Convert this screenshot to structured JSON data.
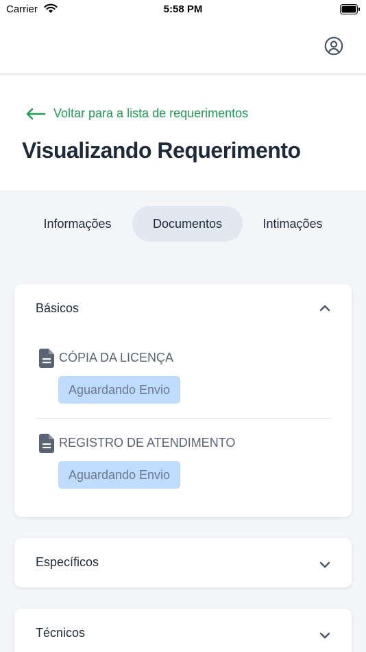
{
  "status_bar": {
    "carrier": "Carrier",
    "time": "5:58 PM"
  },
  "header": {
    "profile_icon": "user-circle-icon"
  },
  "title_section": {
    "back_link": "Voltar para a lista de requerimentos",
    "title": "Visualizando Requerimento"
  },
  "tabs": [
    {
      "label": "Informações",
      "active": false
    },
    {
      "label": "Documentos",
      "active": true
    },
    {
      "label": "Intimações",
      "active": false
    }
  ],
  "sections": [
    {
      "title": "Básicos",
      "expanded": true,
      "documents": [
        {
          "name": "CÓPIA DA LICENÇA",
          "status": "Aguardando Envio"
        },
        {
          "name": "REGISTRO DE ATENDIMENTO",
          "status": "Aguardando Envio"
        }
      ]
    },
    {
      "title": "Específicos",
      "expanded": false
    },
    {
      "title": "Técnicos",
      "expanded": false
    }
  ],
  "colors": {
    "accent_green": "#1f9d55",
    "badge_bg": "#bfdbfe",
    "active_tab_bg": "#e2e8f0",
    "page_bg": "#f3f5f8"
  }
}
